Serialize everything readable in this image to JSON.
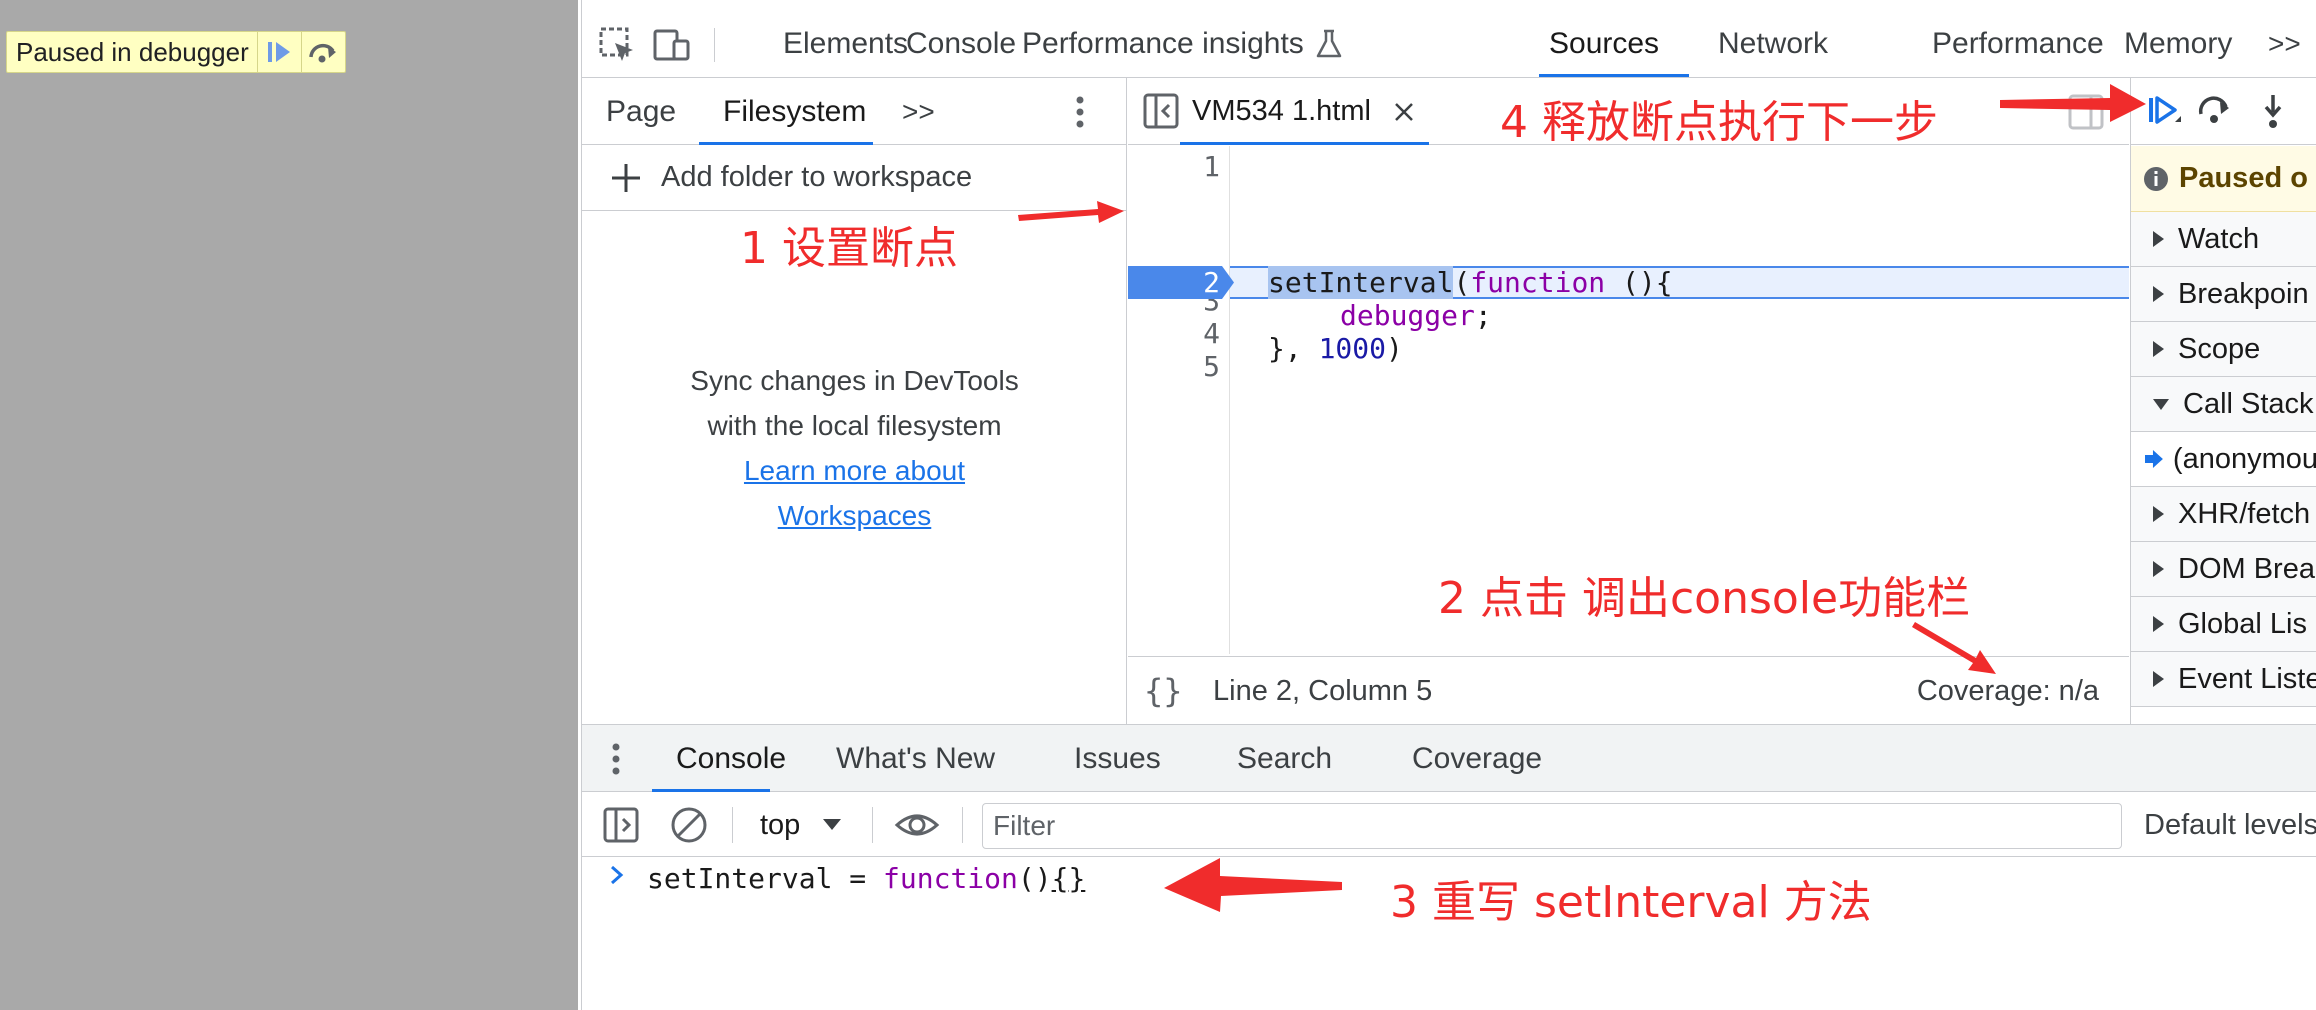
{
  "page": {
    "paused_label": "Paused in debugger"
  },
  "toolbar": {
    "tabs": [
      "Elements",
      "Console",
      "Performance insights",
      "Sources",
      "Network",
      "Performance",
      "Memory"
    ],
    "more": ">>"
  },
  "navigator": {
    "tabs": [
      "Page",
      "Filesystem"
    ],
    "more": ">>",
    "add_folder": "Add folder to workspace",
    "sync_line1": "Sync changes in DevTools",
    "sync_line2": "with the local filesystem",
    "link_line1": "Learn more about",
    "link_line2": "Workspaces"
  },
  "editor": {
    "file_tab": "VM534 1.html",
    "lines": [
      "1",
      "2",
      "3",
      "4",
      "5"
    ],
    "code": {
      "l2_fn": "setInterval",
      "l2_paren": "(",
      "l2_kw": "function",
      "l2_rest": " (){",
      "l3_kw": "debugger",
      "l3_rest": ";",
      "l4_pre": "}, ",
      "l4_num": "1000",
      "l4_post": ")"
    },
    "status_position": "Line 2, Column 5",
    "status_coverage": "Coverage: n/a"
  },
  "debugger": {
    "paused_banner": "Paused o",
    "panes": [
      "Watch",
      "Breakpoin",
      "Scope",
      "Call Stack"
    ],
    "call_frame": "(anonymou",
    "panes_after": [
      "XHR/fetch",
      "DOM Brea",
      "Global Lis",
      "Event Liste"
    ]
  },
  "drawer": {
    "tabs": [
      "Console",
      "What's New",
      "Issues",
      "Search",
      "Coverage"
    ],
    "context": "top",
    "filter_placeholder": "Filter",
    "levels": "Default levels",
    "console_code": {
      "pre": "setInterval = ",
      "kw": "function",
      "paren": "()",
      "braces": "{}"
    }
  },
  "annotations": {
    "a1": "1 设置断点",
    "a2": "2 点击 调出console功能栏",
    "a3": "3 重写 setInterval 方法",
    "a4": "4 释放断点执行下一步"
  },
  "colors": {
    "accent": "#1a73e8",
    "annotation": "#f02c2c",
    "paused_bg": "#ffffc2"
  }
}
